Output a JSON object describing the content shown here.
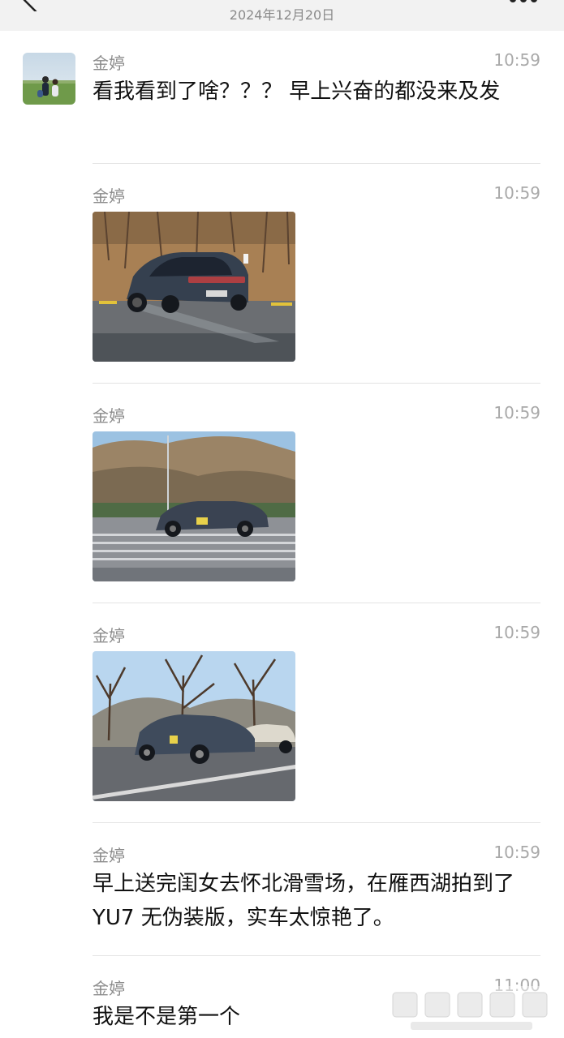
{
  "header": {
    "title": "",
    "date": "2024年12月20日"
  },
  "messages": [
    {
      "sender": "金婷",
      "time": "10:59",
      "text": "看我看到了啥？？？ 早上兴奋的都没来及发"
    },
    {
      "sender": "金婷",
      "time": "10:59",
      "image": "car-photo-parking"
    },
    {
      "sender": "金婷",
      "time": "10:59",
      "image": "car-photo-crosswalk"
    },
    {
      "sender": "金婷",
      "time": "10:59",
      "image": "car-photo-trees"
    },
    {
      "sender": "金婷",
      "time": "10:59",
      "text": "早上送完闺女去怀北滑雪场，在雁西湖拍到了 YU7 无伪装版，实车太惊艳了。"
    },
    {
      "sender": "金婷",
      "time": "11:00",
      "text": "我是不是第一个"
    }
  ],
  "icons": {
    "back": "chevron-left-icon",
    "more": "more-dots-icon"
  },
  "colors": {
    "header_bg": "#f2f2f2",
    "sender": "#8b8b8b",
    "time": "#a9a9a9",
    "divider": "#e3e3e3"
  }
}
